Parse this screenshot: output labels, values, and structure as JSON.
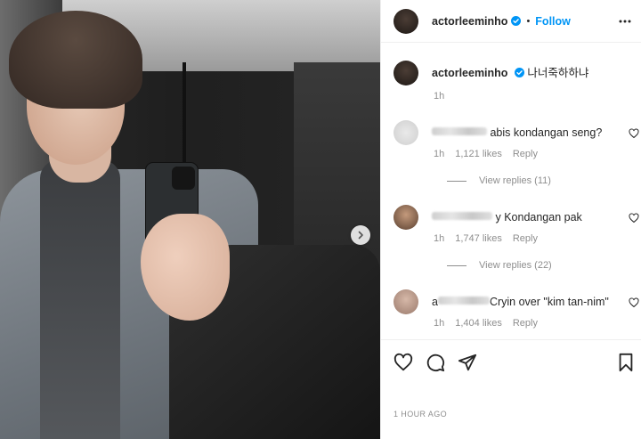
{
  "post": {
    "username": "actorleeminho",
    "follow_label": "Follow",
    "dot": "•",
    "caption": "나너죽하하냐",
    "caption_time": "1h",
    "timestamp": "1 HOUR AGO"
  },
  "comments": [
    {
      "text": "abis kondangan seng?",
      "time": "1h",
      "likes": "1,121 likes",
      "reply_label": "Reply",
      "view_replies": "View replies (11)"
    },
    {
      "text": "y Kondangan pak",
      "time": "1h",
      "likes": "1,747 likes",
      "reply_label": "Reply",
      "view_replies": "View replies (22)"
    },
    {
      "text_prefix": "a",
      "text": "Cryin over \"kim tan-nim\"",
      "time": "1h",
      "likes": "1,404 likes",
      "reply_label": "Reply"
    }
  ],
  "icons": {
    "verified": "verified-badge-icon",
    "more": "more-options-icon",
    "next": "chevron-right-icon",
    "like": "heart-icon",
    "comment": "comment-icon",
    "share": "paper-plane-icon",
    "save": "bookmark-icon"
  },
  "colors": {
    "accent": "#0095f6",
    "verified": "#0095f6",
    "muted": "#8e8e8e"
  }
}
